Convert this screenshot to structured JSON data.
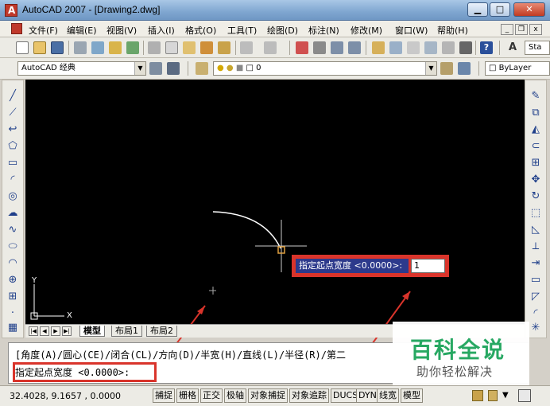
{
  "window": {
    "title": "AutoCAD 2007 - [Drawing2.dwg]",
    "minimize": "▁",
    "maximize": "□",
    "close": "✕"
  },
  "menubar": {
    "items": [
      "文件(F)",
      "编辑(E)",
      "视图(V)",
      "插入(I)",
      "格式(O)",
      "工具(T)",
      "绘图(D)",
      "标注(N)",
      "修改(M)",
      "窗口(W)",
      "帮助(H)"
    ],
    "mdi_min": "_",
    "mdi_restore": "❐",
    "mdi_close": "x"
  },
  "toolbar": {
    "text_style_value": "Sta",
    "workspace_value": "AutoCAD 经典",
    "layer_value": "0",
    "color_value": "ByLayer"
  },
  "canvas": {
    "ucs_y": "Y",
    "ucs_x": "X",
    "dynamic_prompt": "指定起点宽度 <0.0000>:",
    "dynamic_input_value": "1"
  },
  "tabs": {
    "items": [
      "模型",
      "布局1",
      "布局2"
    ],
    "active": "模型"
  },
  "command": {
    "history": "[角度(A)/圆心(CE)/闭合(CL)/方向(D)/半宽(H)/直线(L)/半径(R)/第二",
    "prompt": "指定起点宽度 <0.0000>:"
  },
  "statusbar": {
    "coordinates": "32.4028, 9.1657 , 0.0000",
    "buttons": [
      "捕捉",
      "栅格",
      "正交",
      "极轴",
      "对象捕捉",
      "对象追踪",
      "DUCS",
      "DYN",
      "线宽",
      "模型"
    ]
  },
  "watermark": {
    "title": "百科全说",
    "subtitle": "助你轻松解决"
  },
  "colors": {
    "canvas": "#000000",
    "highlight": "#d9342b",
    "dynamic_label_bg": "#2d3a8c",
    "watermark_green": "#27a862"
  }
}
